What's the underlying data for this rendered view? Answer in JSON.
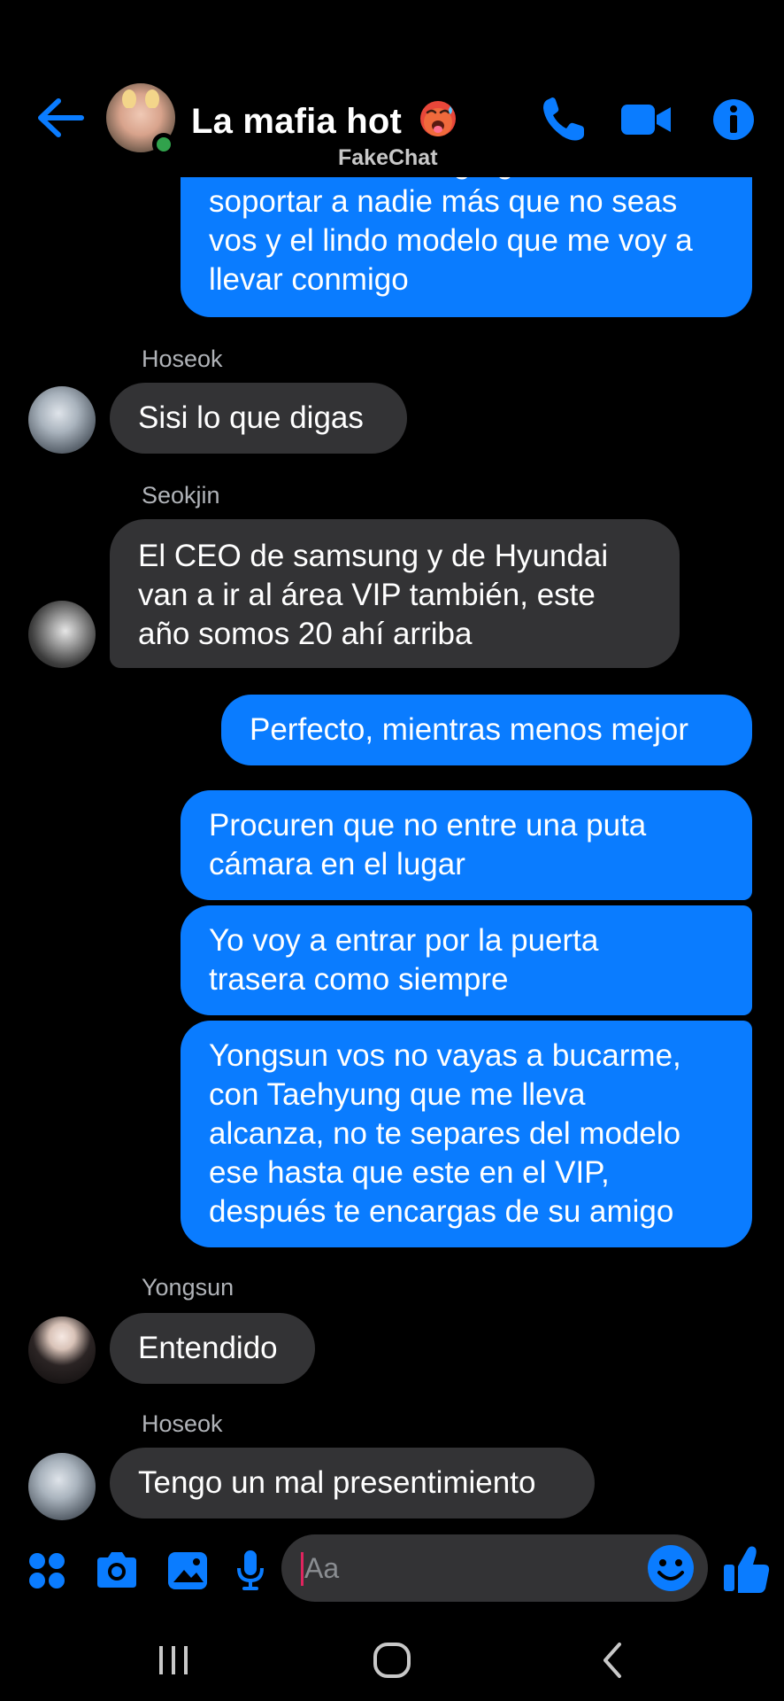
{
  "header": {
    "title": "La mafia hot",
    "watermark": "FakeChat",
    "accent_color": "#0a7cff",
    "icons": [
      "back-arrow-icon",
      "phone-icon",
      "video-camera-icon",
      "info-icon",
      "hot-face-emoji"
    ]
  },
  "messages": {
    "m1": {
      "text": "entendido. No tengo ganas de\nsoportar a nadie más que no seas\nvos y el lindo modelo que me voy a\nllevar conmigo"
    },
    "m2_sender": "Hoseok",
    "m2": {
      "text": "Sisi lo que digas"
    },
    "m3_sender": "Seokjin",
    "m3": {
      "text": "El CEO de samsung y de Hyundai\nvan a ir al área VIP también, este\naño somos 20 ahí arriba"
    },
    "m4": {
      "text": "Perfecto, mientras menos mejor"
    },
    "m5": {
      "text": "Procuren que no entre una puta\ncámara en el lugar"
    },
    "m6": {
      "text": "Yo voy a entrar por la puerta\ntrasera como siempre"
    },
    "m7": {
      "text": "Yongsun vos no vayas a bucarme,\ncon Taehyung que me lleva\nalcanza, no te separes del modelo\nese hasta que este en el VIP,\ndespués te encargas de su amigo"
    },
    "m8_sender": "Yongsun",
    "m8": {
      "text": "Entendido"
    },
    "m9_sender": "Hoseok",
    "m9": {
      "text": "Tengo un mal presentimiento"
    }
  },
  "composer": {
    "placeholder": "Aa",
    "icons": [
      "apps-grid-icon",
      "camera-icon",
      "gallery-icon",
      "microphone-icon",
      "emoji-icon",
      "thumbs-up-icon"
    ]
  },
  "navbar": {
    "icons": [
      "recent-apps-icon",
      "home-icon",
      "back-icon"
    ]
  },
  "colors": {
    "outgoing_bubble": "#0a7cff",
    "incoming_bubble": "#333335",
    "sender_name": "#b0b3b8",
    "online": "#31a24c"
  }
}
